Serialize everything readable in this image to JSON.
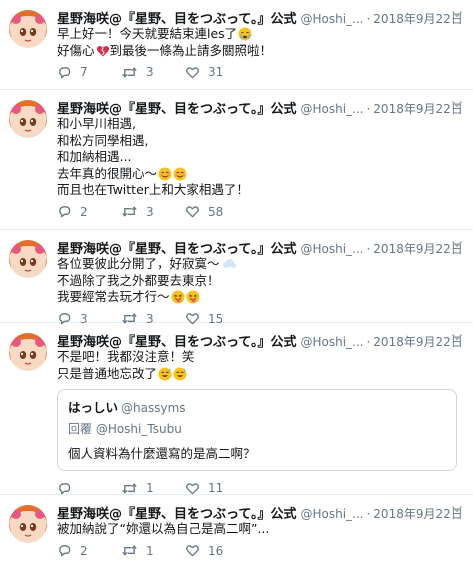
{
  "tweets": [
    {
      "name": "星野海咲@『星野、目をつぶって。』公式",
      "handle": "@Hoshi_...",
      "time": "2018年9月22日",
      "lines": [
        "早上好一！今天就要結束連les了",
        "好傷心",
        "到最後一條為止請多關照啦！"
      ],
      "reply": "7",
      "retweet": "3",
      "like": "31"
    },
    {
      "name": "星野海咲@『星野、目をつぶって。』公式",
      "handle": "@Hoshi_...",
      "time": "2018年9月22日",
      "lines": [
        "和小早川相遇,",
        "和松方同學相遇,",
        "和加納相遇...",
        "去年真的很開心～",
        "而且也在Twitter上和大家相遇了！"
      ],
      "reply": "2",
      "retweet": "3",
      "like": "58"
    },
    {
      "name": "星野海咲@『星野、目をつぶって。』公式",
      "handle": "@Hoshi_...",
      "time": "2018年9月22日",
      "lines": [
        "各位要彼此分開了，好寂寞～",
        "不過除了我之外都要去東京！",
        "我要經常去玩才行～"
      ],
      "reply": "3",
      "retweet": "3",
      "like": "15"
    },
    {
      "name": "星野海咲@『星野、目をつぶって。』公式",
      "handle": "@Hoshi_...",
      "time": "2018年9月22日",
      "lines": [
        "不是吧！我都沒注意！笑",
        "只是普通地忘改了"
      ],
      "quote": {
        "name": "はっしい",
        "handle": "@hassyms",
        "reply_to": "回覆 @Hoshi_Tsubu",
        "text": "個人資料為什麼還寫的是高二啊？"
      },
      "reply": "",
      "retweet": "1",
      "like": "11"
    },
    {
      "name": "星野海咲@『星野、目をつぶって。』公式",
      "handle": "@Hoshi_...",
      "time": "2018年9月22日",
      "lines": [
        "被加納說了“妳還以為自己是高二啊”..."
      ],
      "reply": "2",
      "retweet": "1",
      "like": "16"
    }
  ],
  "icons": {
    "reply": "reply-icon",
    "retweet": "retweet-icon",
    "like": "heart-icon",
    "caret": "chevron-down-icon"
  },
  "colors": {
    "text": "#14171a",
    "muted": "#657786",
    "divider": "#e6ecf0"
  }
}
